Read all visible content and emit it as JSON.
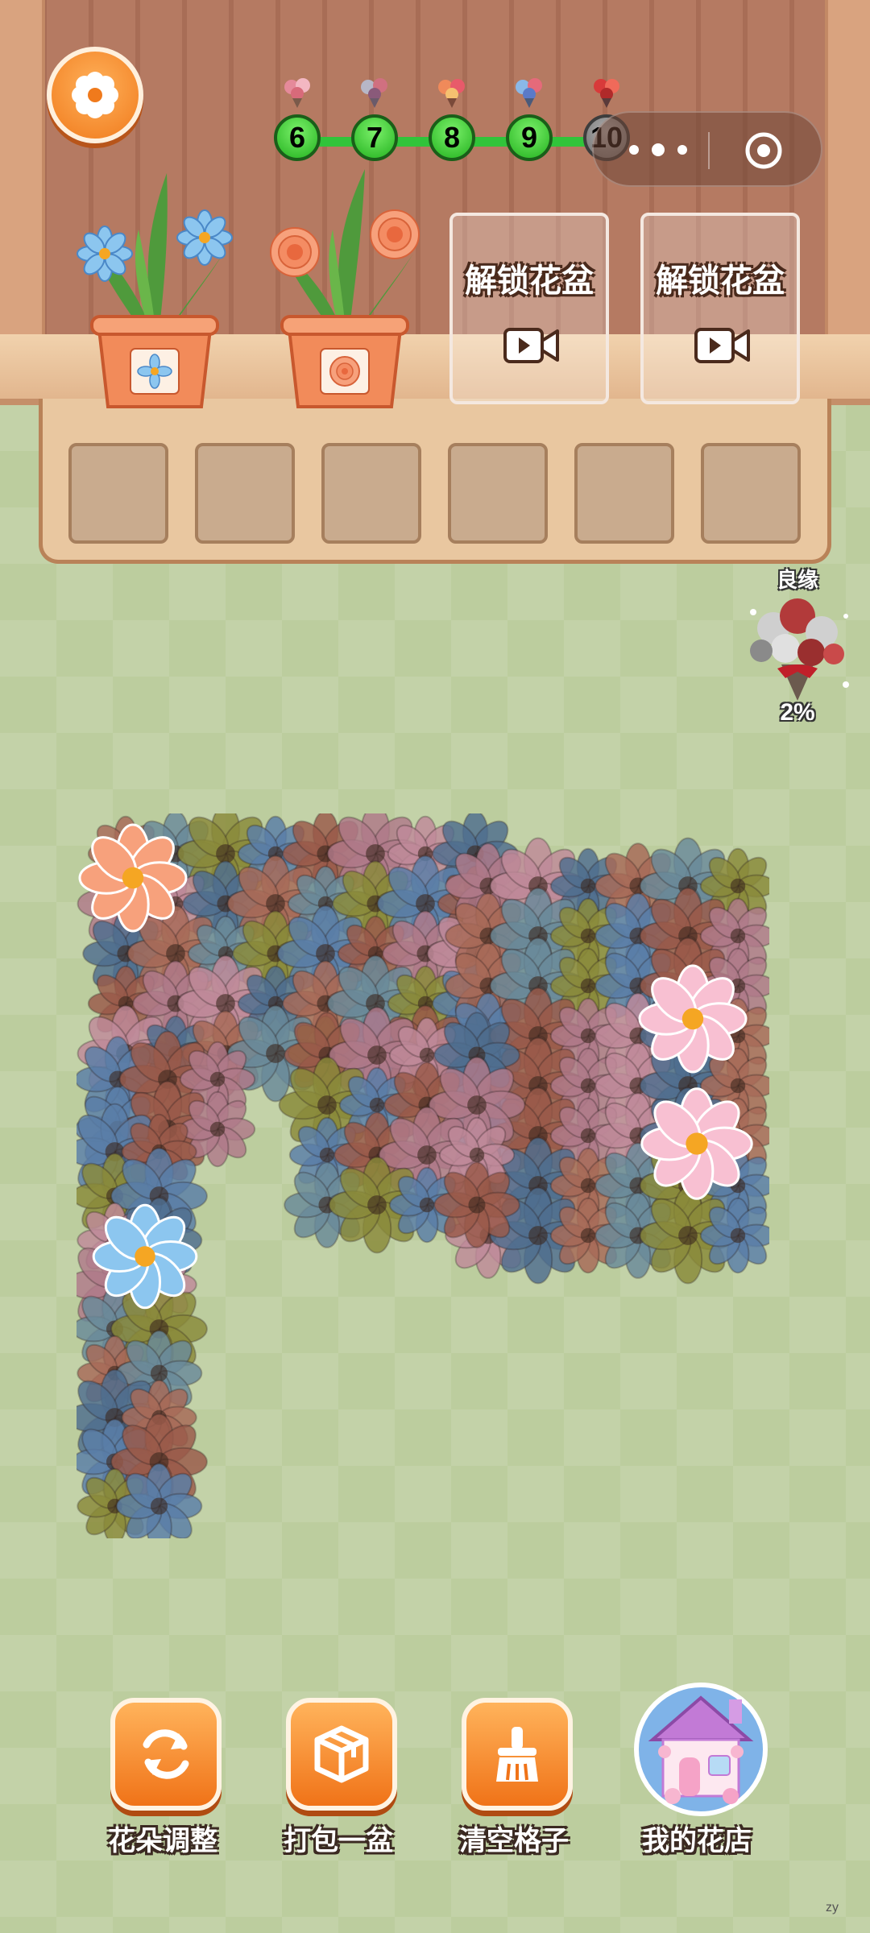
{
  "level_track": {
    "levels": [
      "6",
      "7",
      "8",
      "9",
      "10"
    ],
    "current_index": 3
  },
  "pot_slots": [
    {
      "type": "plant",
      "flower": "blue-daisy"
    },
    {
      "type": "plant",
      "flower": "orange-rose"
    },
    {
      "type": "locked",
      "label": "解锁花盆",
      "icon": "video-icon"
    },
    {
      "type": "locked",
      "label": "解锁花盆",
      "icon": "video-icon"
    }
  ],
  "tray_slots": 6,
  "bouquet_goal": {
    "title": "良缘",
    "percent": "2%"
  },
  "toolbar": {
    "adjust_label": "花朵调整",
    "pack_label": "打包一盆",
    "clear_label": "清空格子",
    "shop_label": "我的花店"
  },
  "watermark": "zy",
  "colors": {
    "accent_orange": "#f07a1c",
    "level_green": "#23b21f",
    "background_green": "#bccd9e",
    "wood": "#b57a62"
  }
}
